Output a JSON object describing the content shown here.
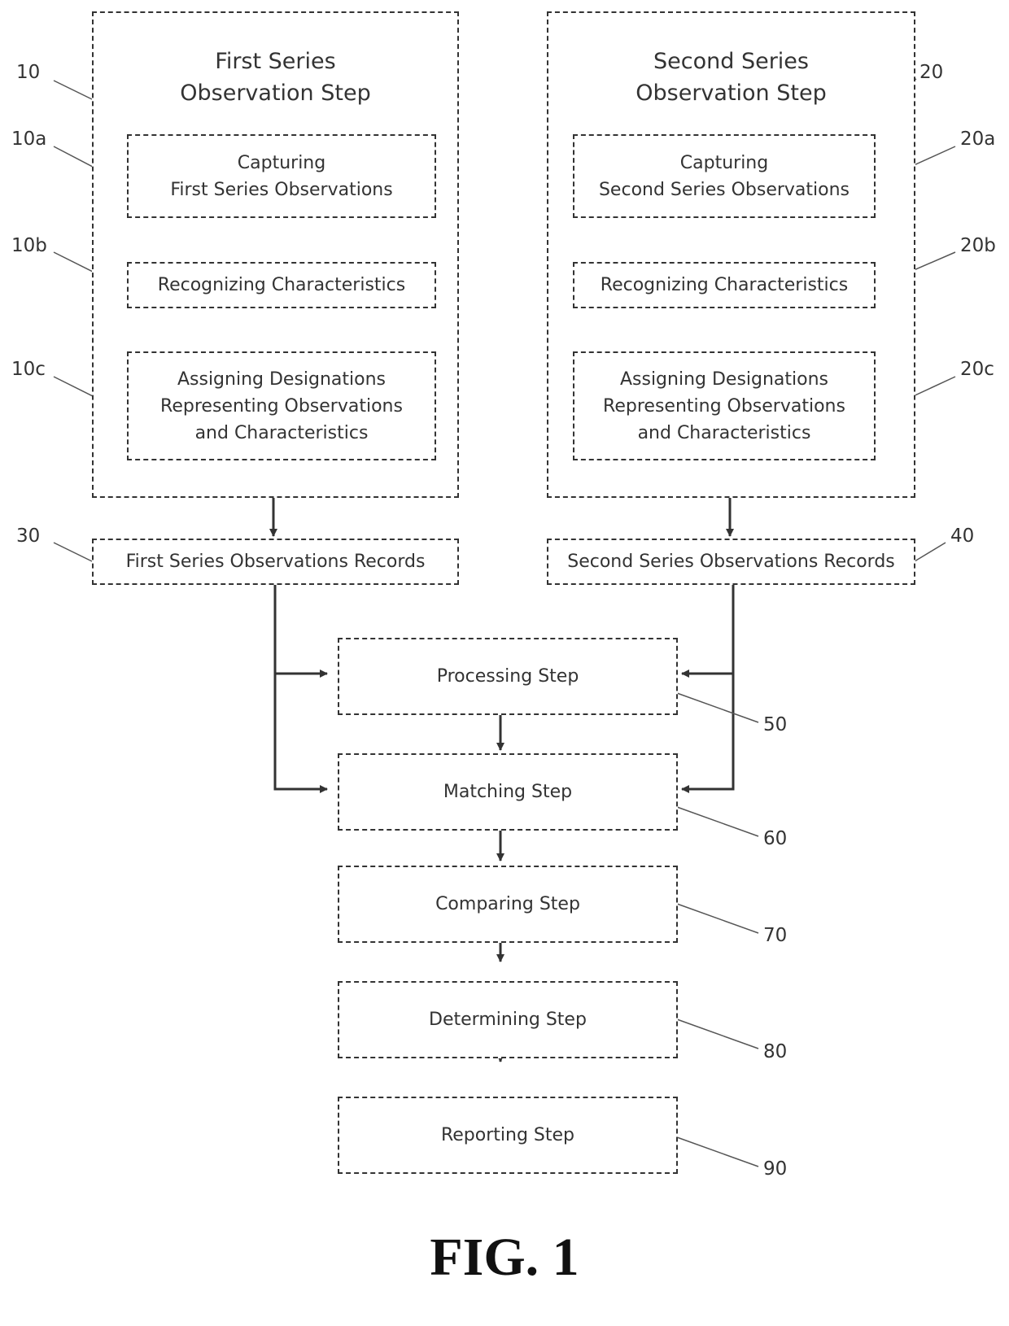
{
  "figure_label": "FIG. 1",
  "left_group": {
    "title": "First Series\nObservation Step",
    "ref": "10",
    "steps": [
      {
        "label": "Capturing\nFirst Series Observations",
        "ref": "10a"
      },
      {
        "label": "Recognizing Characteristics",
        "ref": "10b"
      },
      {
        "label": "Assigning Designations\nRepresenting Observations\nand Characteristics",
        "ref": "10c"
      }
    ],
    "record": {
      "label": "First Series Observations Records",
      "ref": "30"
    }
  },
  "right_group": {
    "title": "Second Series\nObservation Step",
    "ref": "20",
    "steps": [
      {
        "label": "Capturing\nSecond Series Observations",
        "ref": "20a"
      },
      {
        "label": "Recognizing Characteristics",
        "ref": "20b"
      },
      {
        "label": "Assigning Designations\nRepresenting Observations\nand Characteristics",
        "ref": "20c"
      }
    ],
    "record": {
      "label": "Second Series Observations Records",
      "ref": "40"
    }
  },
  "main_steps": [
    {
      "label": "Processing Step",
      "ref": "50"
    },
    {
      "label": "Matching Step",
      "ref": "60"
    },
    {
      "label": "Comparing Step",
      "ref": "70"
    },
    {
      "label": "Determining Step",
      "ref": "80"
    },
    {
      "label": "Reporting Step",
      "ref": "90"
    }
  ]
}
